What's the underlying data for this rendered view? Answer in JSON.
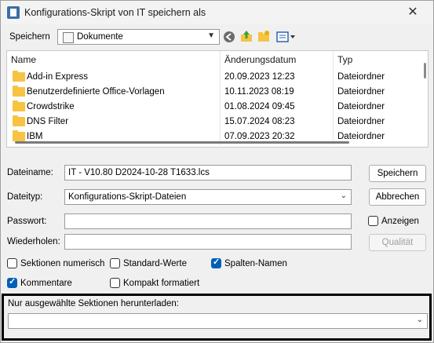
{
  "window": {
    "title": "Konfigurations-Skript von IT speichern als",
    "close_glyph": "✕"
  },
  "location": {
    "label": "Speichern",
    "folder": "Dokumente"
  },
  "columns": {
    "name": "Name",
    "date": "Änderungsdatum",
    "type": "Typ"
  },
  "files": [
    {
      "name": "Add-in Express",
      "date": "20.09.2023 12:23",
      "type": "Dateiordner"
    },
    {
      "name": "Benutzerdefinierte Office-Vorlagen",
      "date": "10.11.2023 08:19",
      "type": "Dateiordner"
    },
    {
      "name": "Crowdstrike",
      "date": "01.08.2024 09:45",
      "type": "Dateiordner"
    },
    {
      "name": "DNS Filter",
      "date": "15.07.2024 08:23",
      "type": "Dateiordner"
    },
    {
      "name": "IBM",
      "date": "07.09.2023 20:32",
      "type": "Dateiordner"
    }
  ],
  "form": {
    "filename_label": "Dateiname:",
    "filename_value": "IT - V10.80 D2024-10-28 T1633.lcs",
    "filetype_label": "Dateityp:",
    "filetype_value": "Konfigurations-Skript-Dateien",
    "password_label": "Passwort:",
    "repeat_label": "Wiederholen:"
  },
  "buttons": {
    "save": "Speichern",
    "cancel": "Abbrechen",
    "quality": "Qualität",
    "show": "Anzeigen"
  },
  "options": {
    "numbered": {
      "label": "Sektionen numerisch",
      "checked": false
    },
    "defaults": {
      "label": "Standard-Werte",
      "checked": false
    },
    "column_names": {
      "label": "Spalten-Namen",
      "checked": true
    },
    "comments": {
      "label": "Kommentare",
      "checked": true
    },
    "compact": {
      "label": "Kompakt formatiert",
      "checked": false
    }
  },
  "sections": {
    "label": "Nur ausgewählte Sektionen herunterladen:",
    "value": ""
  }
}
